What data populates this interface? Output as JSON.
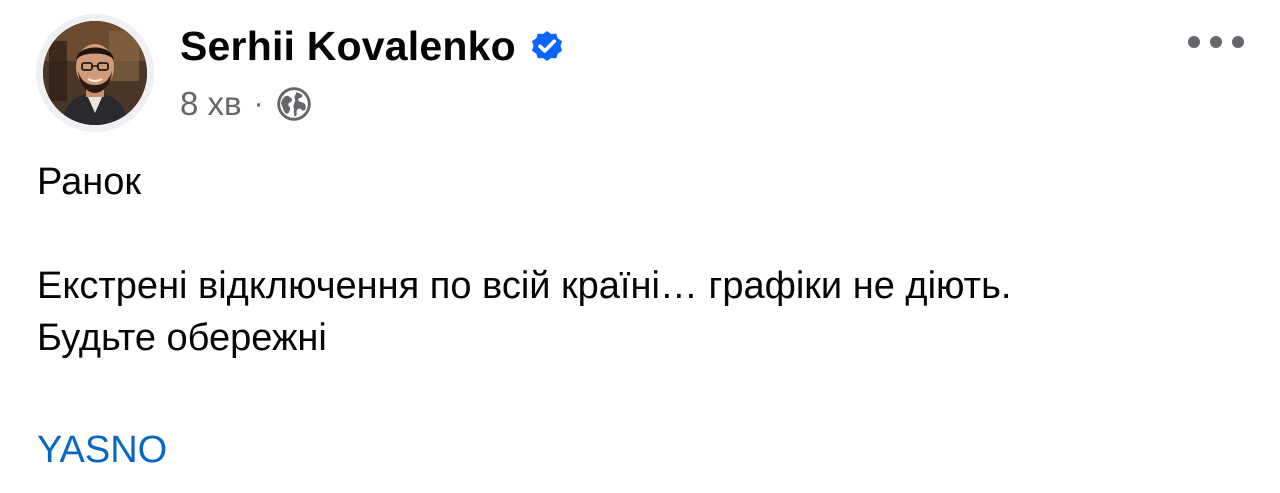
{
  "post": {
    "author": {
      "name": "Serhii Kovalenko",
      "verified": true,
      "avatar_icon": "profile-photo"
    },
    "meta": {
      "time": "8 хв",
      "separator": "·",
      "audience_icon": "globe-icon"
    },
    "menu_icon": "more-horizontal-icon",
    "body": {
      "line1": "Ранок",
      "line2": "Екстрені відключення по всій країні… графіки не діють.",
      "line3": "Будьте обережні"
    },
    "link": {
      "label": "YASNO"
    },
    "colors": {
      "text": "#050505",
      "secondary": "#65676b",
      "link": "#0866c4",
      "verified_badge": "#0866ff"
    }
  }
}
